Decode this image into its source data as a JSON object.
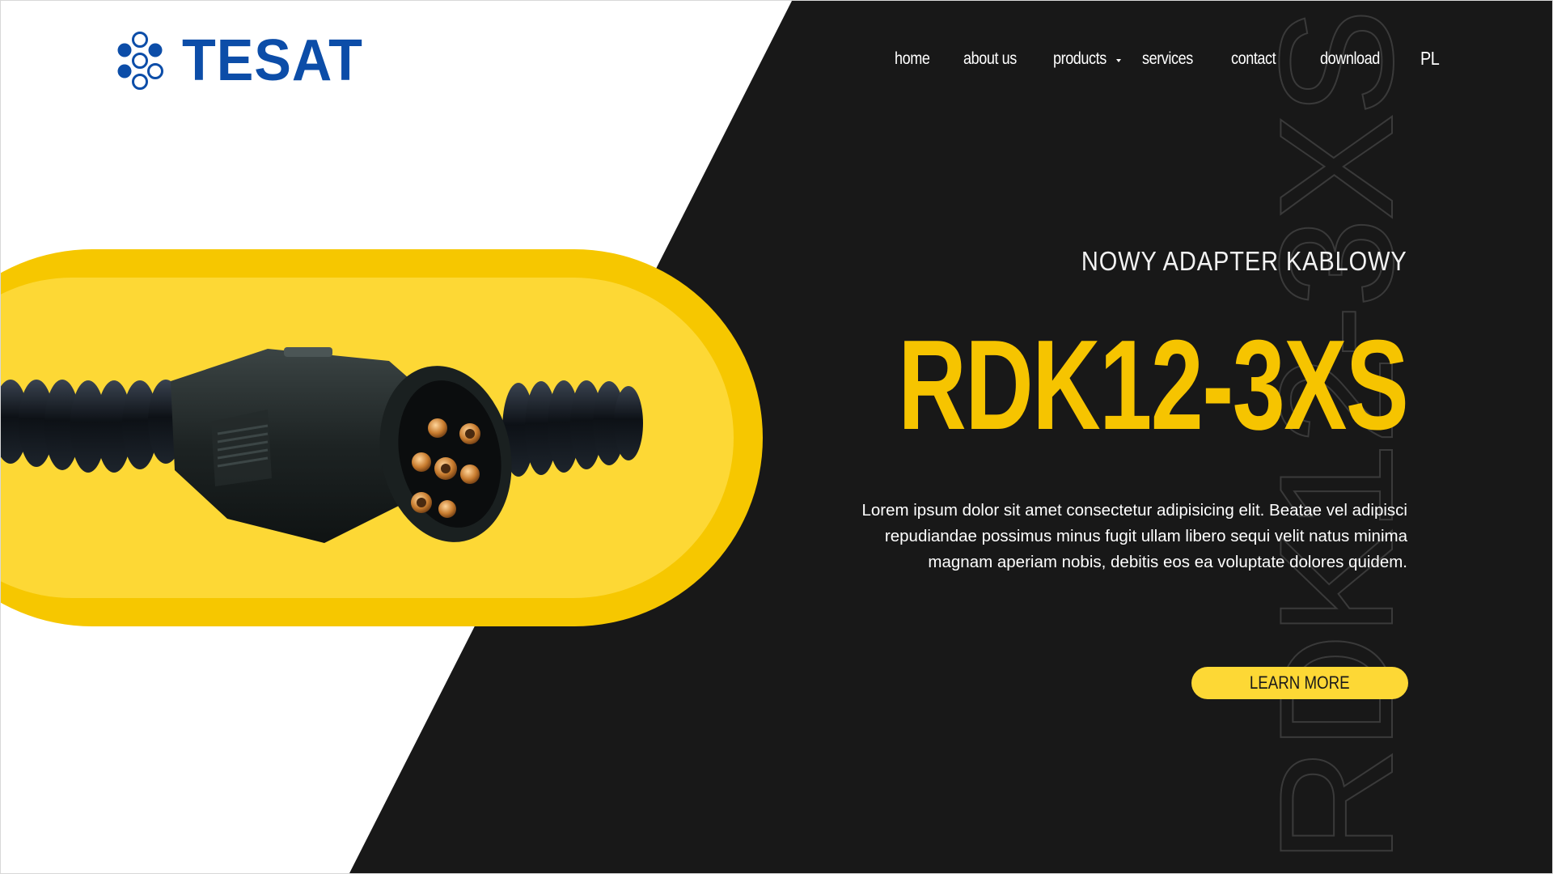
{
  "brand": {
    "name": "TESAT",
    "color": "#0c4da8"
  },
  "nav": {
    "items": [
      {
        "label": "home"
      },
      {
        "label": "about us"
      },
      {
        "label": "products",
        "has_dropdown": true
      },
      {
        "label": "services"
      },
      {
        "label": "contact"
      },
      {
        "label": "download"
      }
    ],
    "language": "PL"
  },
  "hero": {
    "subtitle": "NOWY ADAPTER KABLOWY",
    "title": "RDK12-3XS",
    "description": "Lorem ipsum dolor sit amet consectetur adipisicing elit. Beatae vel adipisci repudiandae possimus minus fugit ullam libero sequi velit natus minima magnam aperiam nobis, debitis eos ea voluptate dolores quidem.",
    "cta_label": "LEARN MORE",
    "watermark_text": "RDK12-3XS",
    "product_image": "coiled-trailer-cable-7-pin-plug"
  },
  "colors": {
    "dark_background": "#181818",
    "accent_yellow": "#f6c400",
    "pill_light_yellow": "#fdd835",
    "text_light": "#ffffff"
  }
}
